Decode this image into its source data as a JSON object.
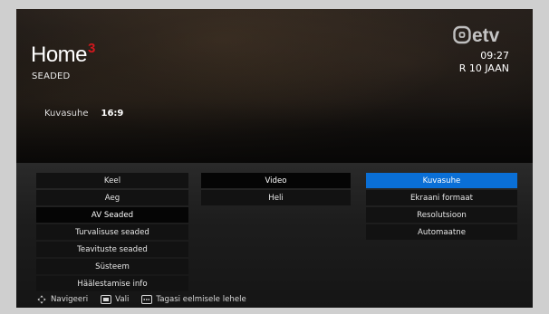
{
  "brand": {
    "name": "Home",
    "mark": "3",
    "mark_color": "#d2181d"
  },
  "page": {
    "title": "SEADED",
    "setting_label": "Kuvasuhe",
    "setting_value": "16:9"
  },
  "channel": {
    "logo_icon": "etv-logo",
    "time": "09:27",
    "date": "R 10 JAAN"
  },
  "menu": {
    "level1": [
      {
        "label": "Keel",
        "state": "normal"
      },
      {
        "label": "Aeg",
        "state": "normal"
      },
      {
        "label": "AV Seaded",
        "state": "active"
      },
      {
        "label": "Turvalisuse seaded",
        "state": "normal"
      },
      {
        "label": "Teavituste seaded",
        "state": "normal"
      },
      {
        "label": "Süsteem",
        "state": "normal"
      },
      {
        "label": "Häälestamise info",
        "state": "normal"
      }
    ],
    "level2": [
      {
        "label": "Video",
        "state": "active"
      },
      {
        "label": "Heli",
        "state": "normal"
      }
    ],
    "level3": [
      {
        "label": "Kuvasuhe",
        "state": "selected"
      },
      {
        "label": "Ekraani formaat",
        "state": "normal"
      },
      {
        "label": "Resolutsioon",
        "state": "normal"
      },
      {
        "label": "Automaatne",
        "state": "normal"
      }
    ],
    "selected_color": "#0a6fd6"
  },
  "hints": {
    "navigate_icon": "dpad-icon",
    "navigate": "Navigeeri",
    "select_icon": "ok-button-icon",
    "select": "Vali",
    "back_icon": "back-button-icon",
    "back": "Tagasi eelmisele lehele"
  }
}
